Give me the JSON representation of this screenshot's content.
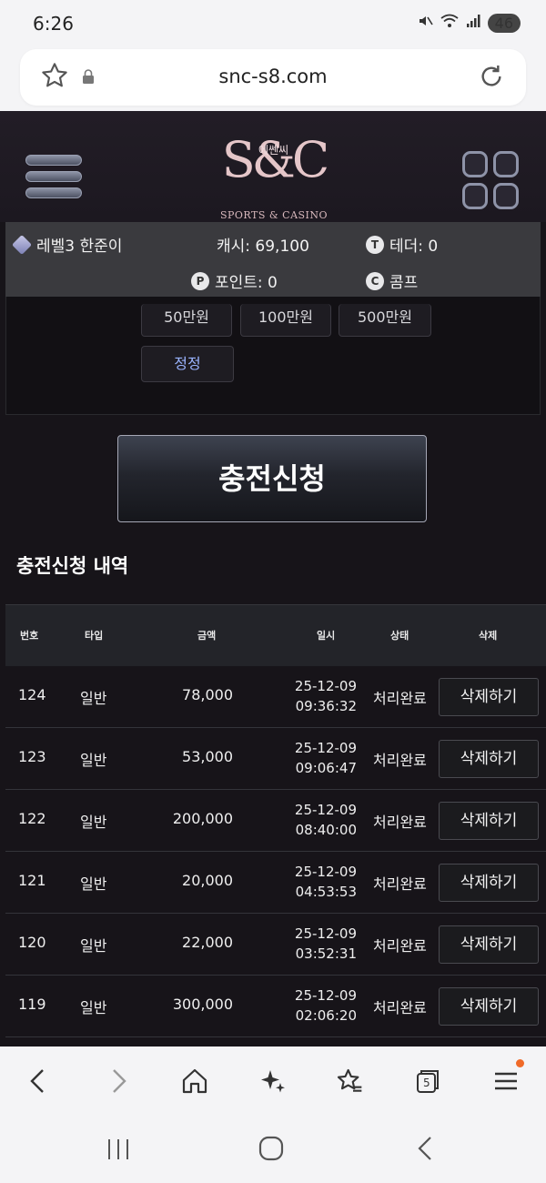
{
  "status_bar": {
    "time": "6:26",
    "battery": "46"
  },
  "browser": {
    "url": "snc-s8.com",
    "tab_count": "5"
  },
  "header": {
    "logo_mark": "S&C",
    "logo_korean": "에쎈씨",
    "logo_sub": "SPORTS & CASINO"
  },
  "user_info": {
    "level_name": "레벨3 한준이",
    "cash": "캐시: 69,100",
    "tether": "테더: 0",
    "points": "포인트: 0",
    "comp": "콤프"
  },
  "form": {
    "amount_buttons": [
      "50만원",
      "100만원",
      "500만원"
    ],
    "correct_label": "정정"
  },
  "charge_button": "충전신청",
  "history": {
    "title": "충전신청 내역",
    "headers": [
      "번호",
      "타입",
      "금액",
      "일시",
      "상태",
      "삭제"
    ],
    "rows": [
      {
        "no": "124",
        "type": "일반",
        "amount": "78,000",
        "date": "25-12-09",
        "time": "09:36:32",
        "status": "처리완료",
        "delete": "삭제하기"
      },
      {
        "no": "123",
        "type": "일반",
        "amount": "53,000",
        "date": "25-12-09",
        "time": "09:06:47",
        "status": "처리완료",
        "delete": "삭제하기"
      },
      {
        "no": "122",
        "type": "일반",
        "amount": "200,000",
        "date": "25-12-09",
        "time": "08:40:00",
        "status": "처리완료",
        "delete": "삭제하기"
      },
      {
        "no": "121",
        "type": "일반",
        "amount": "20,000",
        "date": "25-12-09",
        "time": "04:53:53",
        "status": "처리완료",
        "delete": "삭제하기"
      },
      {
        "no": "120",
        "type": "일반",
        "amount": "22,000",
        "date": "25-12-09",
        "time": "03:52:31",
        "status": "처리완료",
        "delete": "삭제하기"
      },
      {
        "no": "119",
        "type": "일반",
        "amount": "300,000",
        "date": "25-12-09",
        "time": "02:06:20",
        "status": "처리완료",
        "delete": "삭제하기"
      }
    ]
  }
}
